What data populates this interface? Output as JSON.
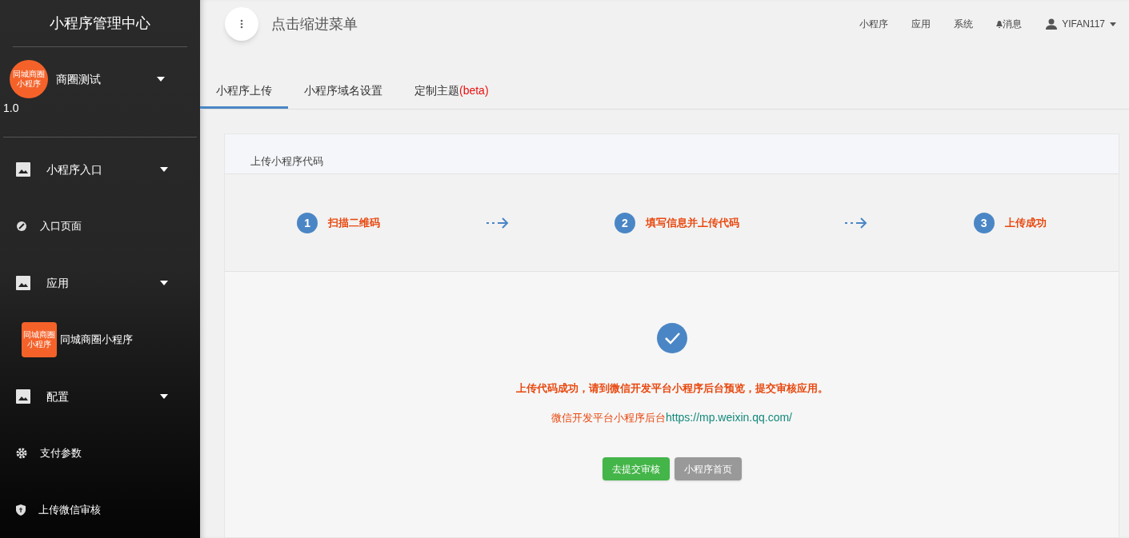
{
  "sidebar": {
    "title": "小程序管理中心",
    "account": {
      "logo_text": "同城商圈小程序",
      "name": "商圈测试",
      "version": "1.0"
    },
    "items": [
      {
        "kind": "group",
        "label": "小程序入口"
      },
      {
        "kind": "page",
        "label": "入口页面"
      },
      {
        "kind": "group",
        "label": "应用"
      },
      {
        "kind": "app",
        "logo_text": "同城商圈小程序",
        "label": "同城商圈小程序"
      },
      {
        "kind": "group",
        "label": "配置"
      },
      {
        "kind": "page",
        "label": "支付参数"
      },
      {
        "kind": "page",
        "label": "上传微信审核"
      }
    ]
  },
  "header": {
    "menu_hint": "点击缩进菜单",
    "nav": [
      "小程序",
      "应用",
      "系统"
    ],
    "messages": "消息",
    "user": "YIFAN117"
  },
  "tabs": [
    {
      "label": "小程序上传",
      "selected": true
    },
    {
      "label": "小程序域名设置",
      "selected": false
    },
    {
      "label": "定制主题",
      "badge": "(beta)",
      "selected": false
    }
  ],
  "panel": {
    "title": "上传小程序代码",
    "steps": [
      {
        "number": "1",
        "label": "扫描二维码"
      },
      {
        "number": "2",
        "label": "填写信息并上传代码"
      },
      {
        "number": "3",
        "label": "上传成功"
      }
    ],
    "message": "上传代码成功，请到微信开发平台小程序后台预览，提交审核应用。",
    "link_prefix": "微信开发平台小程序后台",
    "link": "https://mp.weixin.qq.com/",
    "buttons": [
      {
        "kind": "primary",
        "label": "去提交审核"
      },
      {
        "kind": "secondary",
        "label": "小程序首页"
      }
    ]
  }
}
